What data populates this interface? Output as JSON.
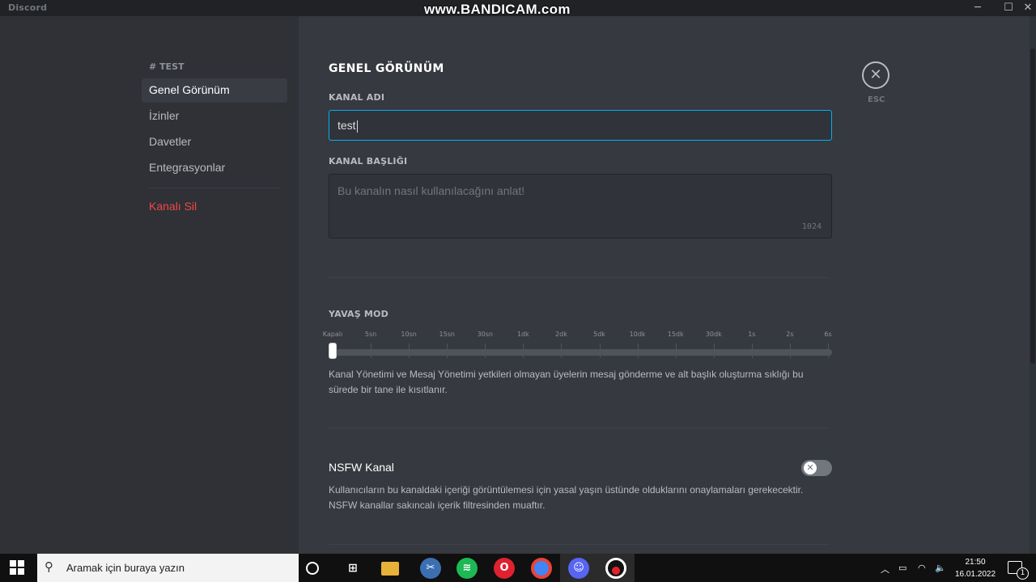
{
  "window": {
    "app_name": "Discord",
    "watermark": "www.BANDICAM.com",
    "minimize": "─",
    "maximize": "☐",
    "close": "✕"
  },
  "sidebar": {
    "header": "# TEST",
    "items": [
      {
        "label": "Genel Görünüm",
        "selected": true
      },
      {
        "label": "İzinler"
      },
      {
        "label": "Davetler"
      },
      {
        "label": "Entegrasyonlar"
      }
    ],
    "delete_label": "Kanalı Sil"
  },
  "main": {
    "title": "GENEL GÖRÜNÜM",
    "channel_name_label": "KANAL ADI",
    "channel_name_value": "test",
    "topic_label": "KANAL BAŞLIĞI",
    "topic_placeholder": "Bu kanalın nasıl kullanılacağını anlat!",
    "topic_counter": "1024",
    "slowmode_label": "YAVAŞ MOD",
    "slowmode_ticks": [
      "Kapalı",
      "5sn",
      "10sn",
      "15sn",
      "30sn",
      "1dk",
      "2dk",
      "5dk",
      "10dk",
      "15dk",
      "30dk",
      "1s",
      "2s",
      "6s"
    ],
    "slowmode_selected_index": 0,
    "slowmode_desc_1": "Kanal Yönetimi ve Mesaj Yönetimi yetkileri olmayan üyelerin mesaj gönderme ve alt başlık oluşturma sıklığı bu",
    "slowmode_desc_2": "sürede bir tane ile kısıtlanır.",
    "nsfw_title": "NSFW Kanal",
    "nsfw_enabled": false,
    "nsfw_desc_1": "Kullanıcıların bu kanaldaki içeriği görüntülemesi için yasal yaşın üstünde olduklarını onaylamaları gerekecektir.",
    "nsfw_desc_2": "NSFW kanallar sakıncalı içerik filtresinden muaftır.",
    "close_glyph": "✕",
    "close_label": "ESC"
  },
  "taskbar": {
    "search_placeholder": "Aramak için buraya yazın",
    "time": "21:50",
    "date": "16.01.2022",
    "notification_count": "1"
  },
  "colors": {
    "accent": "#00b0f4",
    "danger": "#f04747",
    "sidebar_bg": "#2f3136",
    "content_bg": "#36393f"
  }
}
